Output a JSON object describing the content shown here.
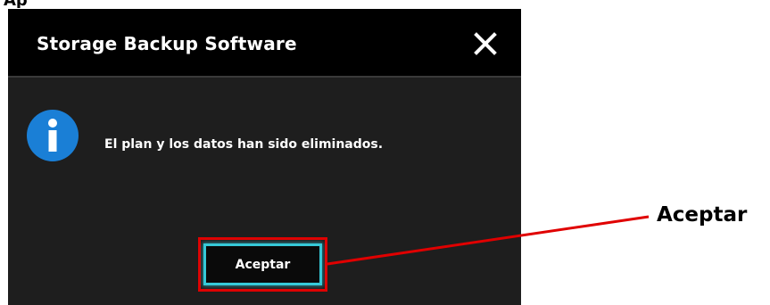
{
  "dialog": {
    "title": "Storage Backup Software",
    "message": "El plan y los datos han sido eliminados.",
    "ok_button_label": "Aceptar",
    "close_icon": "close-icon",
    "info_icon": "info-icon"
  },
  "annotation": {
    "callout_label": "Aceptar",
    "highlight_color": "#e00000"
  },
  "colors": {
    "dialog_background": "#1e1e1e",
    "titlebar_background": "#000000",
    "info_icon_blue": "#1a7fd6",
    "button_border": "#36c9d8"
  }
}
